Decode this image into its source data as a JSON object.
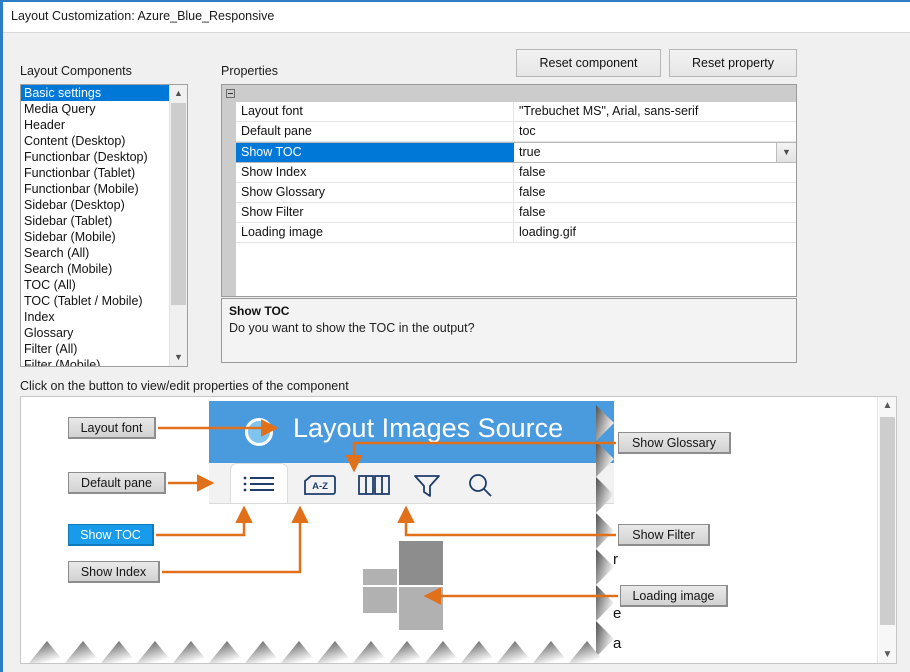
{
  "window": {
    "title": "Layout Customization: Azure_Blue_Responsive"
  },
  "toolbar": {
    "reset_component_label": "Reset component",
    "reset_property_label": "Reset property"
  },
  "components_panel": {
    "label": "Layout Components",
    "items": [
      "Basic settings",
      "Media Query",
      "Header",
      "Content (Desktop)",
      "Functionbar (Desktop)",
      "Functionbar (Tablet)",
      "Functionbar (Mobile)",
      "Sidebar (Desktop)",
      "Sidebar (Tablet)",
      "Sidebar (Mobile)",
      "Search (All)",
      "Search (Mobile)",
      "TOC (All)",
      "TOC (Tablet / Mobile)",
      "Index",
      "Glossary",
      "Filter (All)",
      "Filter (Mobile)"
    ],
    "selected_index": 0,
    "scroll_up_icon": "chevron-up",
    "scroll_down_icon": "chevron-down"
  },
  "properties_panel": {
    "label": "Properties",
    "rows": [
      {
        "name": "Layout font",
        "value": "\"Trebuchet MS\", Arial, sans-serif"
      },
      {
        "name": "Default pane",
        "value": "toc"
      },
      {
        "name": "Show TOC",
        "value": "true"
      },
      {
        "name": "Show Index",
        "value": "false"
      },
      {
        "name": "Show Glossary",
        "value": "false"
      },
      {
        "name": "Show Filter",
        "value": "false"
      },
      {
        "name": "Loading image",
        "value": "loading.gif"
      }
    ],
    "selected_index": 2,
    "dropdown_icon": "chevron-down-icon"
  },
  "description": {
    "title": "Show TOC",
    "text": "Do you want to show the TOC in the output?"
  },
  "hint": "Click on the button to view/edit properties of the component",
  "preview": {
    "banner_title": "Layout Images Source",
    "banner_color": "#4a9ade",
    "accent_color": "#e1701a",
    "selected_callout_color": "#179bea",
    "tabs": [
      {
        "name": "toc-tab",
        "icon": "list-icon"
      },
      {
        "name": "index-tab",
        "icon": "a-z-icon",
        "label": "A-Z"
      },
      {
        "name": "glossary-tab",
        "icon": "book-icon"
      },
      {
        "name": "filter-tab",
        "icon": "funnel-icon"
      },
      {
        "name": "search-tab",
        "icon": "magnifier-icon"
      }
    ],
    "active_tab_index": 0,
    "callouts": [
      {
        "key": "layout_font",
        "label": "Layout font",
        "selected": false
      },
      {
        "key": "default_pane",
        "label": "Default pane",
        "selected": false
      },
      {
        "key": "show_toc",
        "label": "Show TOC",
        "selected": true
      },
      {
        "key": "show_index",
        "label": "Show Index",
        "selected": false
      },
      {
        "key": "show_glossary",
        "label": "Show Glossary",
        "selected": false
      },
      {
        "key": "show_filter",
        "label": "Show Filter",
        "selected": false
      },
      {
        "key": "loading_image",
        "label": "Loading image",
        "selected": false
      }
    ],
    "scroll_up_icon": "chevron-up",
    "scroll_down_icon": "chevron-down"
  }
}
